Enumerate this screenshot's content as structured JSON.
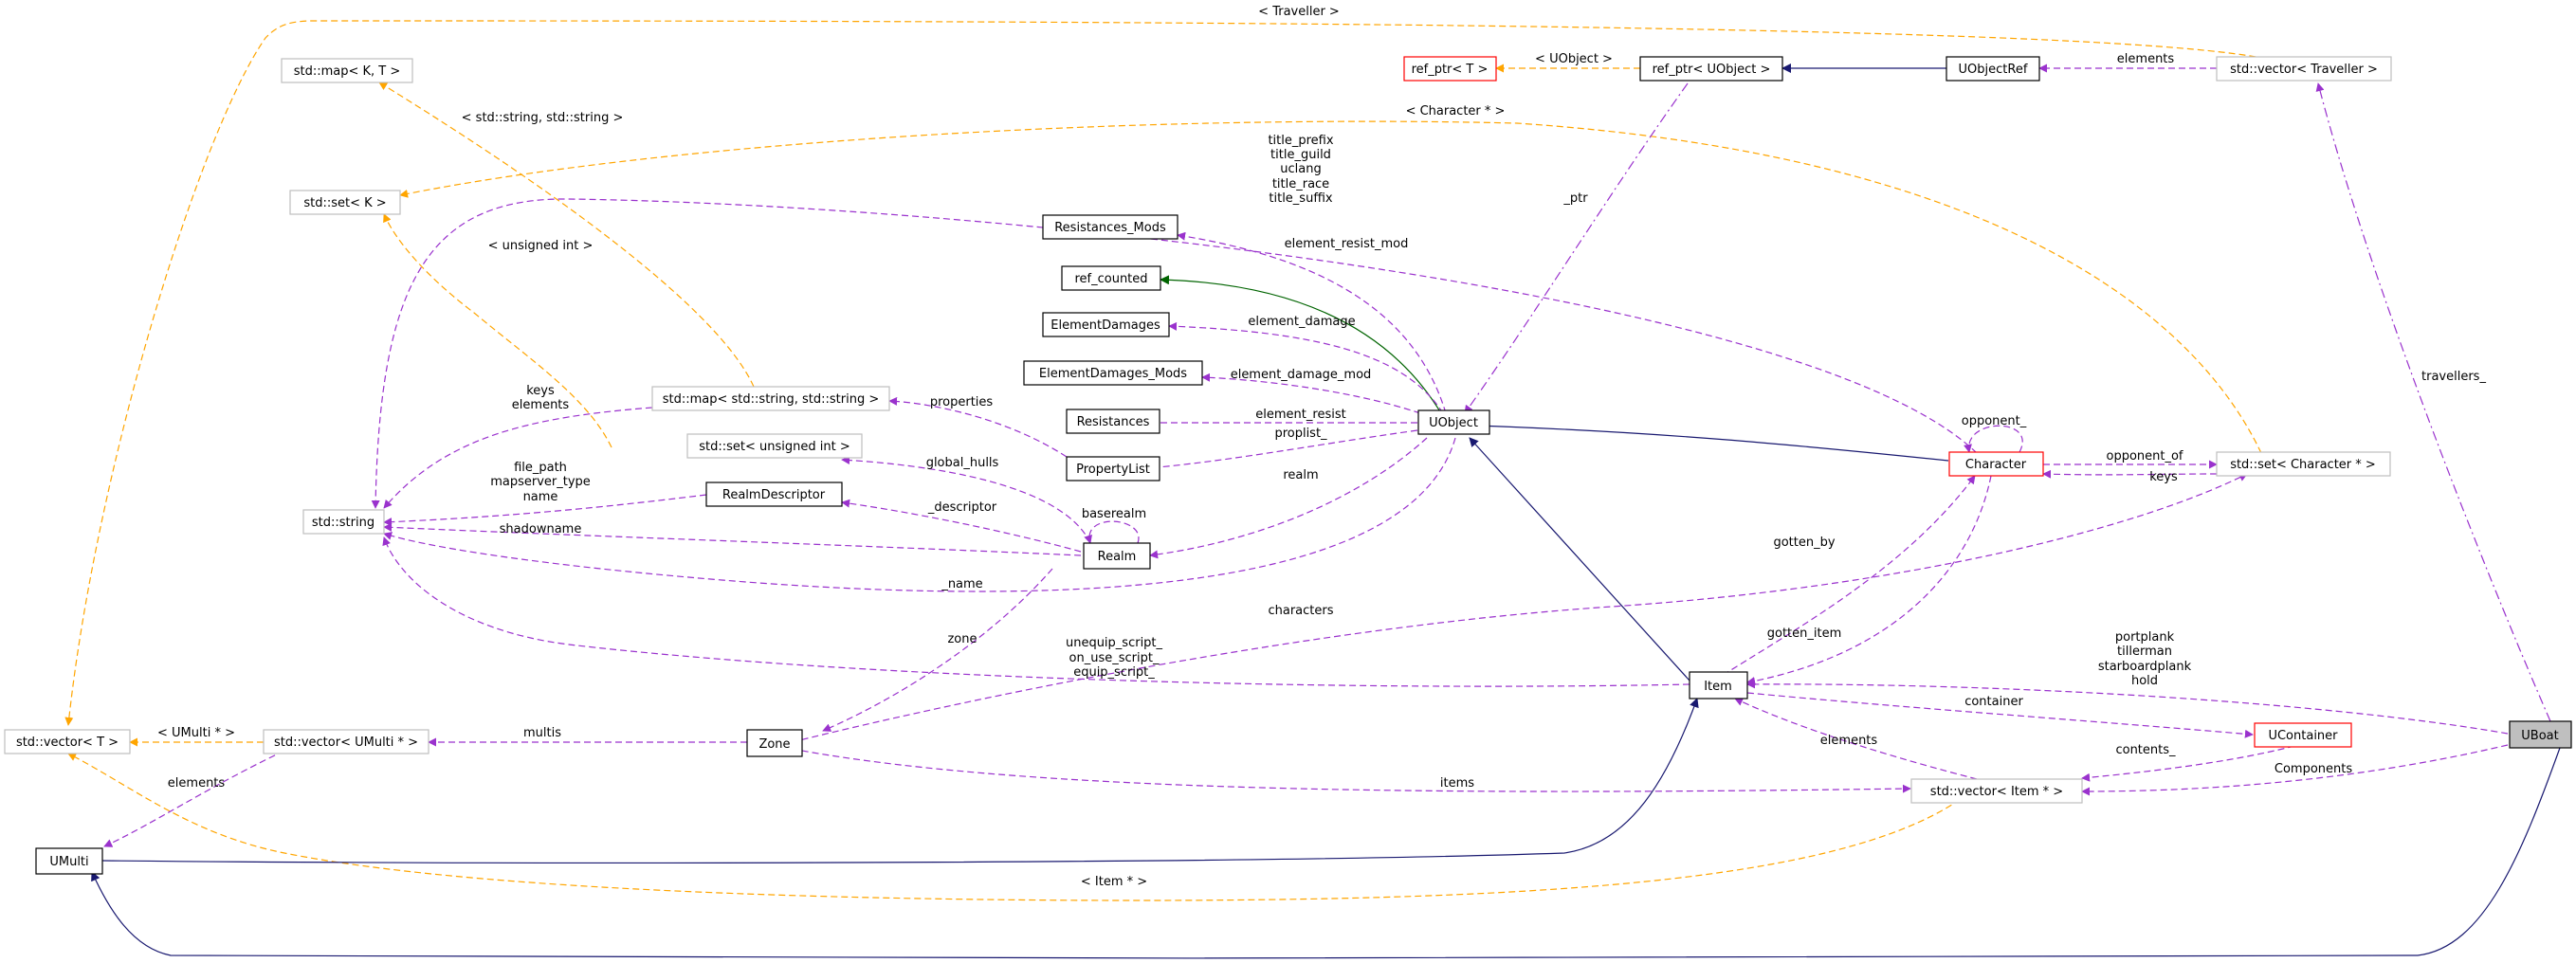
{
  "colors": {
    "inherit": "#191970",
    "usage": "#9a32cd",
    "template": "#ffa500",
    "inherit_green": "#006400",
    "node_border": "#000000",
    "node_border_light": "#bfbfbf",
    "node_border_red": "#ff0000",
    "focus_fill": "#bfbfbf"
  },
  "nodes": {
    "std_map_kt": "std::map< K, T >",
    "ref_ptr_t": "ref_ptr< T >",
    "ref_ptr_uobject": "ref_ptr< UObject >",
    "uobjectref": "UObjectRef",
    "vector_traveller": "std::vector< Traveller >",
    "std_set_k": "std::set< K >",
    "resistances_mods": "Resistances_Mods",
    "ref_counted": "ref_counted",
    "elementdamages": "ElementDamages",
    "elementdamages_mods": "ElementDamages_Mods",
    "map_string_string": "std::map< std::string, std::string >",
    "resistances": "Resistances",
    "uobject": "UObject",
    "set_unsigned": "std::set< unsigned int >",
    "character": "Character",
    "set_character": "std::set< Character * >",
    "propertylist": "PropertyList",
    "realmdescriptor": "RealmDescriptor",
    "std_string": "std::string",
    "realm": "Realm",
    "item": "Item",
    "ucontainer": "UContainer",
    "uboat": "UBoat",
    "vector_t": "std::vector< T >",
    "vector_umulti": "std::vector< UMulti * >",
    "zone": "Zone",
    "vector_item": "std::vector< Item * >",
    "umulti": "UMulti"
  },
  "edge_labels": {
    "traveller": "< Traveller >",
    "uobject_tmpl": "< UObject >",
    "elements_traveller": "elements",
    "string_string": "< std::string, std::string >",
    "character_ptr": "< Character * >",
    "title_prefix": "title_prefix",
    "title_guild": "title_guild",
    "uclang": "uclang",
    "title_race": "title_race",
    "title_suffix": "title_suffix",
    "ptr": "_ptr",
    "unsigned_int": "< unsigned int >",
    "element_resist_mod": "element_resist_mod",
    "element_damage": "element_damage",
    "element_damage_mod": "element_damage_mod",
    "keys_map": "keys",
    "elements_map": "elements",
    "properties": "properties",
    "element_resist": "element_resist",
    "proplist": "proplist_",
    "opponent": "opponent_",
    "opponent_of": "opponent_of",
    "keys_set": "keys",
    "travellers": "travellers_",
    "global_hulls": "global_hulls",
    "file_path": "file_path",
    "mapserver_type": "mapserver_type",
    "name_rd": "name",
    "descriptor": "_descriptor",
    "baserealm": "baserealm",
    "realm": "realm",
    "shadowname": "shadowname",
    "name": "_name",
    "gotten_by": "gotten_by",
    "characters": "characters",
    "gotten_item": "gotten_item",
    "zone": "zone",
    "unequip_script": "unequip_script_",
    "on_use_script": "on_use_script_",
    "equip_script": "equip_script_",
    "portplank": "portplank",
    "tillerman": "tillerman",
    "starboardplank": "starboardplank",
    "hold": "hold",
    "container": "container",
    "umulti_ptr": "< UMulti * >",
    "multis": "multis",
    "elements_umulti": "elements",
    "elements_items": "elements",
    "contents": "contents_",
    "items": "items",
    "components": "Components",
    "item_ptr": "< Item * >"
  }
}
